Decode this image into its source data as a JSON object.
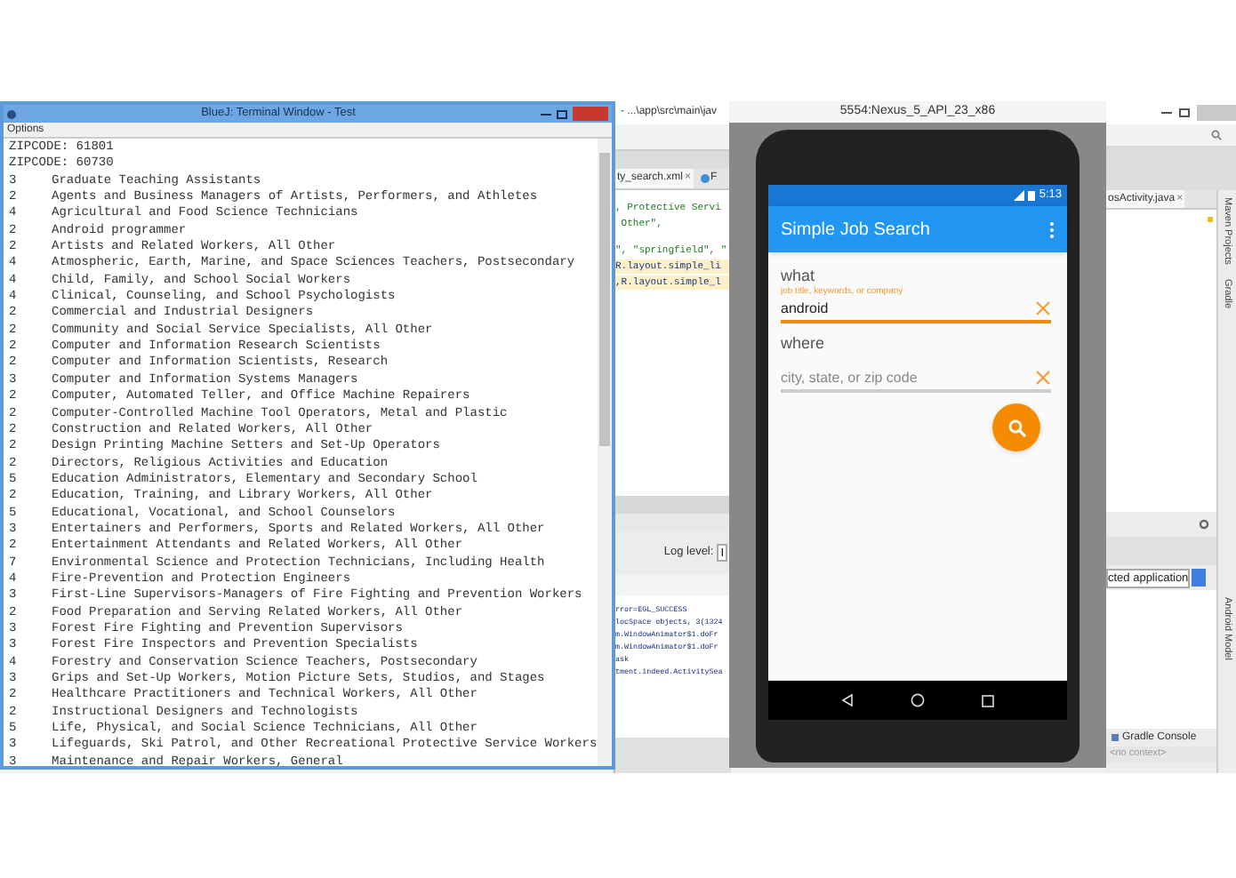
{
  "terminal": {
    "title": "BlueJ: Terminal Window - Test",
    "menu": [
      "Options"
    ],
    "zipcodes": [
      "ZIPCODE: 61801",
      "ZIPCODE: 60730"
    ],
    "rows": [
      {
        "count": "3",
        "title": "Graduate Teaching Assistants"
      },
      {
        "count": "2",
        "title": "Agents and Business Managers of Artists, Performers, and Athletes"
      },
      {
        "count": "4",
        "title": "Agricultural and Food Science Technicians"
      },
      {
        "count": "2",
        "title": "Android programmer"
      },
      {
        "count": "2",
        "title": "Artists and Related Workers, All Other"
      },
      {
        "count": "4",
        "title": "Atmospheric, Earth, Marine, and Space Sciences Teachers, Postsecondary"
      },
      {
        "count": "4",
        "title": "Child, Family, and School Social Workers"
      },
      {
        "count": "4",
        "title": "Clinical, Counseling, and School Psychologists"
      },
      {
        "count": "2",
        "title": "Commercial and Industrial Designers"
      },
      {
        "count": "2",
        "title": "Community and Social Service Specialists, All Other"
      },
      {
        "count": "2",
        "title": "Computer and Information Research Scientists"
      },
      {
        "count": "2",
        "title": "Computer and Information Scientists, Research"
      },
      {
        "count": "3",
        "title": "Computer and Information Systems Managers"
      },
      {
        "count": "2",
        "title": "Computer, Automated Teller, and Office Machine Repairers"
      },
      {
        "count": "2",
        "title": "Computer-Controlled Machine Tool Operators, Metal and Plastic"
      },
      {
        "count": "2",
        "title": "Construction and Related Workers, All Other"
      },
      {
        "count": "2",
        "title": "Design Printing Machine Setters and Set-Up Operators"
      },
      {
        "count": "2",
        "title": "Directors, Religious Activities and Education"
      },
      {
        "count": "5",
        "title": "Education Administrators, Elementary and Secondary School"
      },
      {
        "count": "2",
        "title": "Education, Training, and Library Workers, All Other"
      },
      {
        "count": "5",
        "title": "Educational, Vocational, and School Counselors"
      },
      {
        "count": "3",
        "title": "Entertainers and Performers, Sports and Related Workers, All Other"
      },
      {
        "count": "2",
        "title": "Entertainment Attendants and Related Workers, All Other"
      },
      {
        "count": "7",
        "title": "Environmental Science and Protection Technicians, Including Health"
      },
      {
        "count": "4",
        "title": "Fire-Prevention and Protection Engineers"
      },
      {
        "count": "3",
        "title": "First-Line Supervisors-Managers of Fire Fighting and Prevention Workers"
      },
      {
        "count": "2",
        "title": "Food Preparation and Serving Related Workers, All Other"
      },
      {
        "count": "3",
        "title": "Forest Fire Fighting and Prevention Supervisors"
      },
      {
        "count": "3",
        "title": "Forest Fire Inspectors and Prevention Specialists"
      },
      {
        "count": "4",
        "title": "Forestry and Conservation Science Teachers, Postsecondary"
      },
      {
        "count": "3",
        "title": "Grips and Set-Up Workers, Motion Picture Sets, Studios, and Stages"
      },
      {
        "count": "2",
        "title": "Healthcare Practitioners and Technical Workers, All Other"
      },
      {
        "count": "2",
        "title": "Instructional Designers and Technologists"
      },
      {
        "count": "5",
        "title": "Life, Physical, and Social Science Technicians, All Other"
      },
      {
        "count": "3",
        "title": "Lifeguards, Ski Patrol, and Other Recreational Protective Service Workers"
      },
      {
        "count": "3",
        "title": "Maintenance and Repair Workers, General"
      }
    ]
  },
  "ide": {
    "title": "- ...\\app\\src\\main\\jav",
    "left_tabs": [
      {
        "label": "ty_search.xml",
        "close": "×"
      },
      {
        "label": "F"
      }
    ],
    "right_tabs": [
      {
        "label": "osActivity.java",
        "close": "×"
      }
    ],
    "code_lines": [
      {
        "text": ", Protective Servi",
        "highlighted": false
      },
      {
        "text": " Other\",",
        "highlighted": false
      },
      {
        "text": "\", \"springfield\", \"",
        "highlighted": false
      },
      {
        "text": "R.layout.simple_li",
        "highlighted": true
      },
      {
        "text": ",R.layout.simple_l",
        "highlighted": true
      }
    ],
    "log_level_label": "Log level:",
    "log_level_value": "I",
    "log_lines": [
      "rror=EGL_SUCCESS",
      "locSpace objects, 3(1324",
      "m.WindowAnimator$1.doFr",
      "m.WindowAnimator$1.doFr",
      "ask",
      "tment.indeed.ActivitySea"
    ],
    "app_selector": "cted application",
    "side_tools": [
      "Maven Projects",
      "Gradle",
      "Android Model"
    ],
    "bottom_tabs": [
      "Gradle Console"
    ],
    "status": "<no context>"
  },
  "emulator": {
    "title": "5554:Nexus_5_API_23_x86",
    "time": "5:13",
    "app_title": "Simple Job Search",
    "fields": [
      {
        "label": "what",
        "hint": "job title, keywords, or company",
        "value": "android",
        "focused": true
      },
      {
        "label": "where",
        "placeholder": "city, state, or zip code",
        "focused": false
      }
    ]
  }
}
